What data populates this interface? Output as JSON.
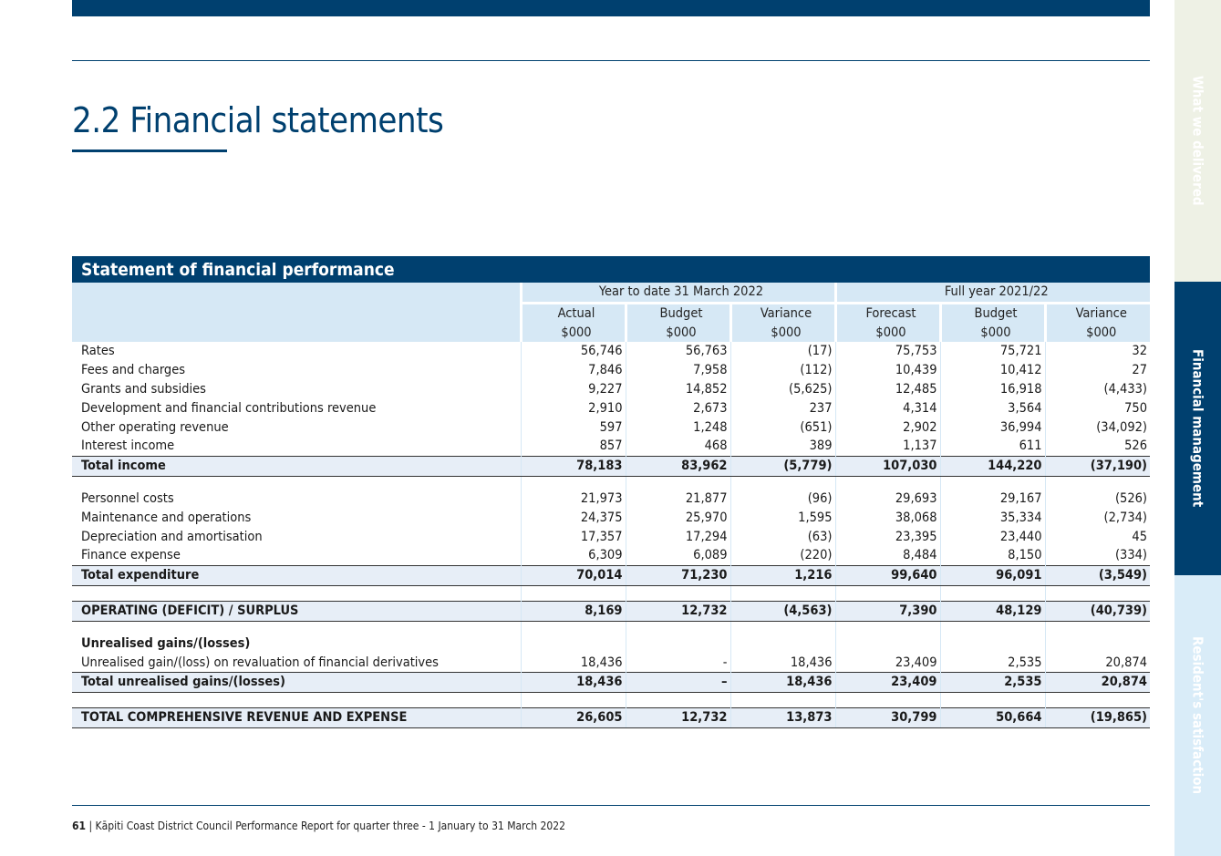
{
  "section_title": "2.2 Financial statements",
  "side_tabs": [
    "What we delivered",
    "Financial management",
    "Resident's satisfaction"
  ],
  "table": {
    "title": "Statement of financial performance",
    "group_headers": [
      "Year to date 31 March 2022",
      "Full year 2021/22"
    ],
    "column_headers": [
      {
        "label": "Actual",
        "unit": "$000"
      },
      {
        "label": "Budget",
        "unit": "$000"
      },
      {
        "label": "Variance",
        "unit": "$000"
      },
      {
        "label": "Forecast",
        "unit": "$000"
      },
      {
        "label": "Budget",
        "unit": "$000"
      },
      {
        "label": "Variance",
        "unit": "$000"
      }
    ],
    "rows": [
      {
        "label": "Rates",
        "values": [
          "56,746",
          "56,763",
          "(17)",
          "75,753",
          "75,721",
          "32"
        ]
      },
      {
        "label": "Fees and charges",
        "values": [
          "7,846",
          "7,958",
          "(112)",
          "10,439",
          "10,412",
          "27"
        ]
      },
      {
        "label": "Grants and subsidies",
        "values": [
          "9,227",
          "14,852",
          "(5,625)",
          "12,485",
          "16,918",
          "(4,433)"
        ]
      },
      {
        "label": "Development and financial contributions revenue",
        "values": [
          "2,910",
          "2,673",
          "237",
          "4,314",
          "3,564",
          "750"
        ]
      },
      {
        "label": "Other operating revenue",
        "values": [
          "597",
          "1,248",
          "(651)",
          "2,902",
          "36,994",
          "(34,092)"
        ]
      },
      {
        "label": "Interest income",
        "values": [
          "857",
          "468",
          "389",
          "1,137",
          "611",
          "526"
        ]
      },
      {
        "label": "Total income",
        "values": [
          "78,183",
          "83,962",
          "(5,779)",
          "107,030",
          "144,220",
          "(37,190)"
        ]
      },
      {
        "label": "Personnel costs",
        "values": [
          "21,973",
          "21,877",
          "(96)",
          "29,693",
          "29,167",
          "(526)"
        ]
      },
      {
        "label": "Maintenance and operations",
        "values": [
          "24,375",
          "25,970",
          "1,595",
          "38,068",
          "35,334",
          "(2,734)"
        ]
      },
      {
        "label": "Depreciation and amortisation",
        "values": [
          "17,357",
          "17,294",
          "(63)",
          "23,395",
          "23,440",
          "45"
        ]
      },
      {
        "label": "Finance expense",
        "values": [
          "6,309",
          "6,089",
          "(220)",
          "8,484",
          "8,150",
          "(334)"
        ]
      },
      {
        "label": "Total expenditure",
        "values": [
          "70,014",
          "71,230",
          "1,216",
          "99,640",
          "96,091",
          "(3,549)"
        ]
      },
      {
        "label": "OPERATING (DEFICIT) / SURPLUS",
        "values": [
          "8,169",
          "12,732",
          "(4,563)",
          "7,390",
          "48,129",
          "(40,739)"
        ]
      },
      {
        "label": "Unrealised gains/(losses)",
        "values": [
          "",
          "",
          "",
          "",
          "",
          ""
        ]
      },
      {
        "label": "Unrealised gain/(loss) on revaluation of financial derivatives",
        "values": [
          "18,436",
          "-",
          "18,436",
          "23,409",
          "2,535",
          "20,874"
        ]
      },
      {
        "label": "Total unrealised gains/(losses)",
        "values": [
          "18,436",
          "–",
          "18,436",
          "23,409",
          "2,535",
          "20,874"
        ]
      },
      {
        "label": "TOTAL COMPREHENSIVE REVENUE AND EXPENSE",
        "values": [
          "26,605",
          "12,732",
          "13,873",
          "30,799",
          "50,664",
          "(19,865)"
        ]
      }
    ]
  },
  "footer": {
    "page_number": "61",
    "separator": "|",
    "text": "Kāpiti Coast District Council Performance Report for quarter three - 1 January to 31 March 2022"
  }
}
